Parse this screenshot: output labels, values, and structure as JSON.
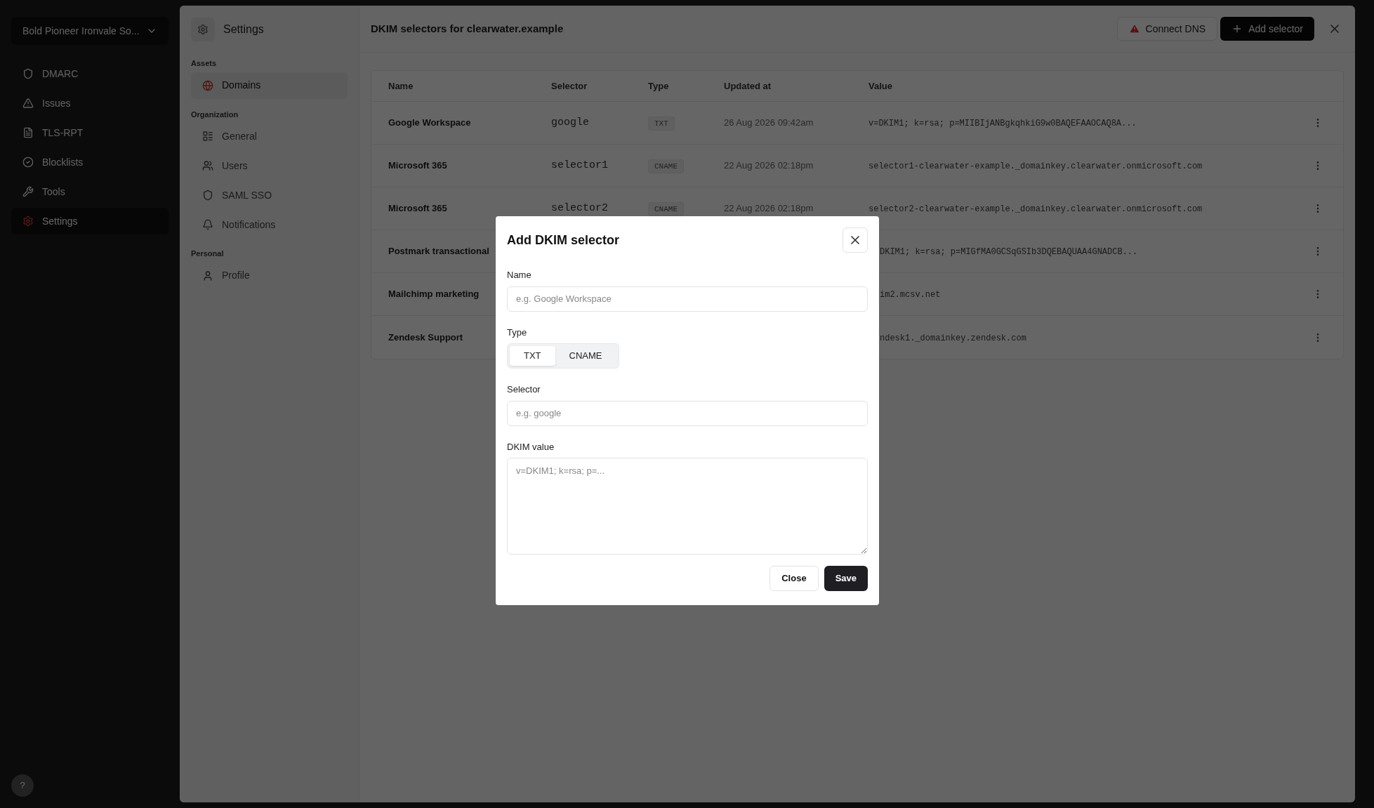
{
  "org_switcher": {
    "label": "Bold Pioneer Ironvale So..."
  },
  "nav": [
    {
      "label": "DMARC",
      "selected": false
    },
    {
      "label": "Issues",
      "selected": false
    },
    {
      "label": "TLS-RPT",
      "selected": false
    },
    {
      "label": "Blocklists",
      "selected": false
    },
    {
      "label": "Tools",
      "selected": false
    },
    {
      "label": "Settings",
      "selected": true
    }
  ],
  "help": {
    "label": "?"
  },
  "settings": {
    "title": "Settings",
    "sections": [
      {
        "heading": "Assets",
        "items": [
          {
            "label": "Domains",
            "selected": true
          }
        ]
      },
      {
        "heading": "Organization",
        "items": [
          {
            "label": "General",
            "selected": false
          },
          {
            "label": "Users",
            "selected": false
          },
          {
            "label": "SAML SSO",
            "selected": false
          },
          {
            "label": "Notifications",
            "selected": false
          }
        ]
      },
      {
        "heading": "Personal",
        "items": [
          {
            "label": "Profile",
            "selected": false
          }
        ]
      }
    ]
  },
  "main": {
    "title": "DKIM selectors for clearwater.example",
    "connect_button": "Connect DNS",
    "add_button": "Add selector"
  },
  "table": {
    "columns": [
      "Name",
      "Selector",
      "Type",
      "Updated at",
      "Value"
    ],
    "rows": [
      {
        "name": "Google Workspace",
        "selector": "google",
        "type": "TXT",
        "updated_at": "26 Aug 2026 09:42am",
        "value": "v=DKIM1; k=rsa; p=MIIBIjANBgkqhkiG9w0BAQEFAAOCAQ8A..."
      },
      {
        "name": "Microsoft 365",
        "selector": "selector1",
        "type": "CNAME",
        "updated_at": "22 Aug 2026 02:18pm",
        "value": "selector1-clearwater-example._domainkey.clearwater.onmicrosoft.com"
      },
      {
        "name": "Microsoft 365",
        "selector": "selector2",
        "type": "CNAME",
        "updated_at": "22 Aug 2026 02:18pm",
        "value": "selector2-clearwater-example._domainkey.clearwater.onmicrosoft.com"
      },
      {
        "name": "Postmark transactional",
        "value": "DKIM1; k=rsa; p=MIGfMA0GCSqGSIb3DQEBAQUAA4GNADCB..."
      },
      {
        "name": "Mailchimp marketing",
        "value": "im2.mcsv.net"
      },
      {
        "name": "Zendesk Support",
        "value": "ndesk1._domainkey.zendesk.com"
      }
    ]
  },
  "dialog": {
    "title": "Add DKIM selector",
    "name_field": {
      "label": "Name",
      "placeholder": "e.g. Google Workspace"
    },
    "type_field": {
      "label": "Type",
      "options": [
        {
          "label": "TXT",
          "selected": true
        },
        {
          "label": "CNAME",
          "selected": false
        }
      ]
    },
    "selector_field": {
      "label": "Selector",
      "placeholder": "e.g. google"
    },
    "value_field": {
      "label": "DKIM value",
      "placeholder": "v=DKIM1; k=rsa; p=..."
    },
    "buttons": [
      "Close",
      "Save"
    ]
  }
}
